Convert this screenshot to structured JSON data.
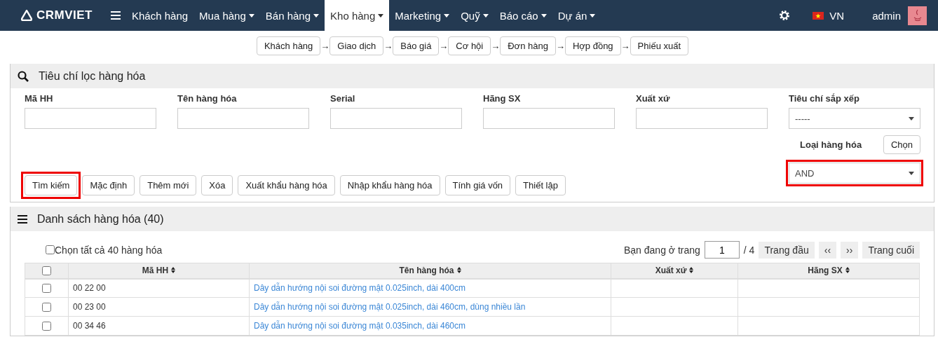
{
  "navbar": {
    "logo": "CRMVIET",
    "menu": [
      {
        "label": "Khách hàng",
        "has_menu": false,
        "selected": false
      },
      {
        "label": "Mua hàng",
        "has_menu": true,
        "selected": false
      },
      {
        "label": "Bán hàng",
        "has_menu": true,
        "selected": false
      },
      {
        "label": "Kho hàng",
        "has_menu": true,
        "selected": true
      },
      {
        "label": "Marketing",
        "has_menu": true,
        "selected": false
      },
      {
        "label": "Quỹ",
        "has_menu": true,
        "selected": false
      },
      {
        "label": "Báo cáo",
        "has_menu": true,
        "selected": false
      },
      {
        "label": "Dự án",
        "has_menu": true,
        "selected": false
      }
    ],
    "language": "VN",
    "user": "admin"
  },
  "workflow": {
    "separator": "→",
    "steps": [
      "Khách hàng",
      "Giao dịch",
      "Báo giá",
      "Cơ hội",
      "Đơn hàng",
      "Hợp đồng",
      "Phiếu xuất"
    ]
  },
  "filter_panel": {
    "title": "Tiêu chí lọc hàng hóa",
    "fields": [
      {
        "label": "Mã HH"
      },
      {
        "label": "Tên hàng hóa"
      },
      {
        "label": "Serial"
      },
      {
        "label": "Hãng SX"
      },
      {
        "label": "Xuất xứ"
      }
    ],
    "sort": {
      "label": "Tiêu chí sắp xếp",
      "value": "-----"
    },
    "category": {
      "label": "Loại hàng hóa",
      "button": "Chọn",
      "value": "AND",
      "highlighted": true
    },
    "buttons": [
      {
        "label": "Tìm kiếm",
        "highlighted": true
      },
      {
        "label": "Mặc định",
        "highlighted": false
      },
      {
        "label": "Thêm mới",
        "highlighted": false
      },
      {
        "label": "Xóa",
        "highlighted": false
      },
      {
        "label": "Xuất khẩu hàng hóa",
        "highlighted": false
      },
      {
        "label": "Nhập khẩu hàng hóa",
        "highlighted": false
      },
      {
        "label": "Tính giá vốn",
        "highlighted": false
      },
      {
        "label": "Thiết lập",
        "highlighted": false
      }
    ]
  },
  "list_panel": {
    "title": "Danh sách hàng hóa (40)",
    "select_all": {
      "label": "Chọn tất cả 40 hàng hóa",
      "checked": false
    },
    "pagination": {
      "prefix": "Bạn đang ở trang",
      "page": "1",
      "total": "/ 4",
      "buttons": [
        "Trang đầu",
        "‹‹",
        "››",
        "Trang cuối"
      ]
    },
    "table": {
      "header_checked": false,
      "columns": [
        "Mã HH",
        "Tên hàng hóa",
        "Xuất xứ",
        "Hãng SX"
      ],
      "rows": [
        {
          "checked": false,
          "code": "00 22 00",
          "name": "Dây dẫn hướng nội soi đường mật 0.025inch, dài 400cm"
        },
        {
          "checked": false,
          "code": "00 23 00",
          "name": "Dây dẫn hướng nội soi đường mật 0.025inch, dài 460cm, dùng nhiều lần"
        },
        {
          "checked": false,
          "code": "00 34 46",
          "name": "Dây dẫn hướng nội soi đường mật 0.035inch, dài 460cm"
        }
      ]
    }
  }
}
